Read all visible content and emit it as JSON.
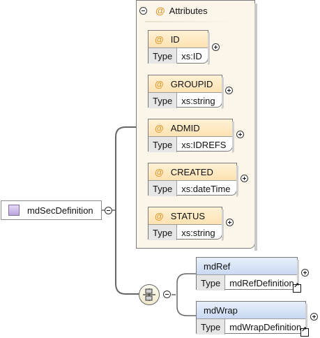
{
  "root": {
    "label": "mdSecDefinition"
  },
  "attributes_group": {
    "title": "Attributes",
    "at_symbol": "@"
  },
  "attributes": [
    {
      "name": "ID",
      "type_label": "Type",
      "type": "xs:ID"
    },
    {
      "name": "GROUPID",
      "type_label": "Type",
      "type": "xs:string"
    },
    {
      "name": "ADMID",
      "type_label": "Type",
      "type": "xs:IDREFS"
    },
    {
      "name": "CREATED",
      "type_label": "Type",
      "type": "xs:dateTime"
    },
    {
      "name": "STATUS",
      "type_label": "Type",
      "type": "xs:string"
    }
  ],
  "children": [
    {
      "name": "mdRef",
      "type_label": "Type",
      "type": "mdRefDefinition"
    },
    {
      "name": "mdWrap",
      "type_label": "Type",
      "type": "mdWrapDefinition"
    }
  ],
  "colors": {
    "attribute_fill": "#fde2b2",
    "element_fill": "#c9d9f2",
    "group_fill": "#fcf6ea",
    "at_symbol": "#e0982c",
    "connector": "#666666"
  },
  "icons": [
    "collapse-icon",
    "expand-icon",
    "sequence-icon",
    "element-icon",
    "reference-icon"
  ]
}
